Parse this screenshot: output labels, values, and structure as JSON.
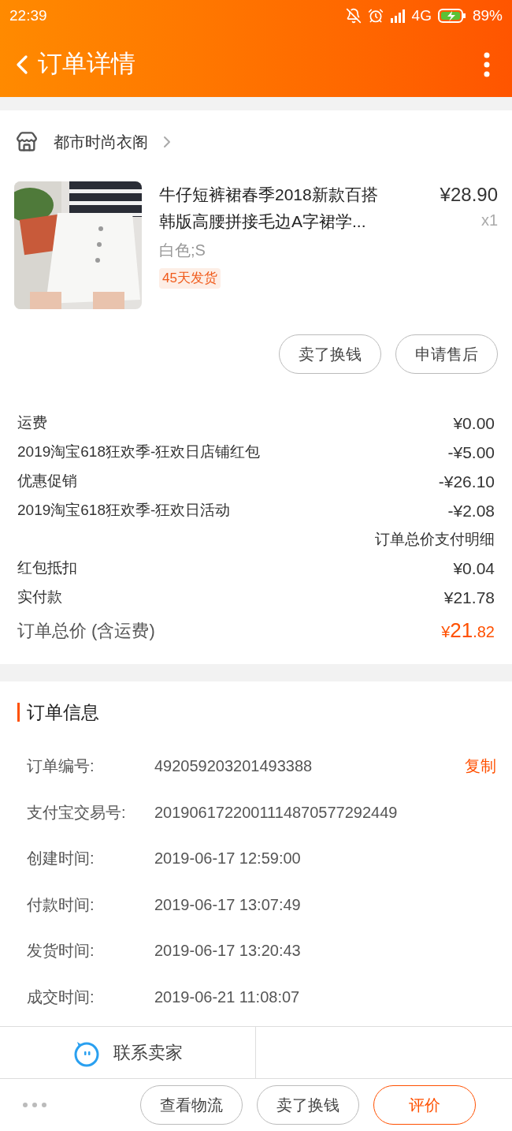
{
  "status_bar": {
    "time": "22:39",
    "network": "4G",
    "battery": "89%"
  },
  "header": {
    "title": "订单详情"
  },
  "shop": {
    "name": "都市时尚衣阁"
  },
  "product": {
    "title": "牛仔短裤裙春季2018新款百搭韩版高腰拼接毛边A字裙学...",
    "price": "¥28.90",
    "quantity": "x1",
    "sku": "白色;S",
    "tag": "45天发货",
    "buttons": [
      "卖了换钱",
      "申请售后"
    ]
  },
  "fees": [
    {
      "kind": "line",
      "label": "运费",
      "value": "¥0.00"
    },
    {
      "kind": "line",
      "label": "2019淘宝618狂欢季-狂欢日店铺红包",
      "value": "-¥5.00"
    },
    {
      "kind": "line",
      "label": "优惠促销",
      "value": "-¥26.10"
    },
    {
      "kind": "line",
      "label": "2019淘宝618狂欢季-狂欢日活动",
      "value": "-¥2.08"
    },
    {
      "kind": "note",
      "label": "订单总价支付明细"
    },
    {
      "kind": "line",
      "label": "红包抵扣",
      "value": "¥0.04"
    },
    {
      "kind": "line",
      "label": "实付款",
      "value": "¥21.78"
    }
  ],
  "total": {
    "label": "订单总价 (含运费)",
    "currency": "¥",
    "integer": "21",
    "decimal": ".82"
  },
  "order_info": {
    "title": "订单信息",
    "rows": [
      {
        "label": "订单编号:",
        "value": "492059203201493388",
        "action": "复制"
      },
      {
        "label": "支付宝交易号:",
        "value": "2019061722001114870577292449"
      },
      {
        "label": "创建时间:",
        "value": "2019-06-17 12:59:00"
      },
      {
        "label": "付款时间:",
        "value": "2019-06-17 13:07:49"
      },
      {
        "label": "发货时间:",
        "value": "2019-06-17 13:20:43"
      },
      {
        "label": "成交时间:",
        "value": "2019-06-21 11:08:07"
      }
    ]
  },
  "contact": {
    "label": "联系卖家"
  },
  "bottom_bar": {
    "buttons": [
      {
        "label": "查看物流",
        "primary": false
      },
      {
        "label": "卖了换钱",
        "primary": false
      },
      {
        "label": "评价",
        "primary": true
      }
    ]
  }
}
